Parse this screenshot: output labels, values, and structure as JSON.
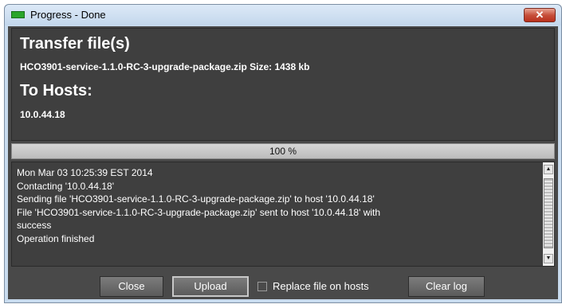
{
  "window": {
    "title": "Progress - Done",
    "close_glyph": "✕",
    "icon": "green-progress-icon"
  },
  "header": {
    "heading_transfer": "Transfer file(s)",
    "file_info": "HCO3901-service-1.1.0-RC-3-upgrade-package.zip Size: 1438 kb",
    "heading_hosts": "To Hosts:",
    "host": "10.0.44.18"
  },
  "progress": {
    "percent": 100,
    "label": "100 %"
  },
  "log": {
    "lines": [
      "Mon Mar 03 10:25:39 EST 2014",
      "Contacting '10.0.44.18'",
      "Sending file  'HCO3901-service-1.1.0-RC-3-upgrade-package.zip' to host '10.0.44.18'",
      "File  'HCO3901-service-1.1.0-RC-3-upgrade-package.zip' sent to host '10.0.44.18' with",
      "success",
      "Operation finished"
    ],
    "scroll_up": "▲",
    "scroll_down": "▼"
  },
  "buttons": {
    "close": "Close",
    "upload": "Upload",
    "replace_label": "Replace file on hosts",
    "replace_checked": false,
    "clear_log": "Clear log"
  },
  "colors": {
    "panel_bg": "#3f3f3f",
    "window_bg": "#494949",
    "title_bar": "#c9dcef",
    "close_red": "#c7503b"
  }
}
